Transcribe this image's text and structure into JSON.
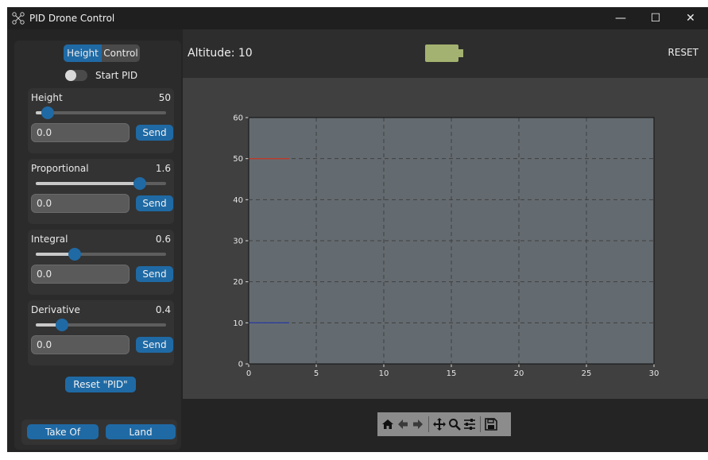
{
  "window": {
    "title": "PID Drone Control",
    "app_icon": "drone-icon"
  },
  "titlebar_controls": [
    {
      "name": "minimize-button",
      "glyph": "—"
    },
    {
      "name": "maximize-button",
      "glyph": "☐"
    },
    {
      "name": "close-button",
      "glyph": "✕"
    }
  ],
  "left_panel": {
    "tabs": [
      "Height",
      "Control"
    ],
    "active_tab": "Height",
    "switch_label": "Start PID",
    "switch_on": false,
    "params": [
      {
        "label": "Height",
        "value": "50",
        "slider_fraction": 0.09,
        "entry": "0.0",
        "button": "Send"
      },
      {
        "label": "Proportional",
        "value": "1.6",
        "slider_fraction": 0.8,
        "entry": "0.0",
        "button": "Send"
      },
      {
        "label": "Integral",
        "value": "0.6",
        "slider_fraction": 0.3,
        "entry": "0.0",
        "button": "Send"
      },
      {
        "label": "Derivative",
        "value": "0.4",
        "slider_fraction": 0.2,
        "entry": "0.0",
        "button": "Send"
      }
    ],
    "reset_pid_label": "Reset \"PID\"",
    "takeoff_label": "Take Of",
    "land_label": "Land"
  },
  "header": {
    "altitude_text": "Altitude: 10",
    "battery_icon": "battery-icon",
    "battery_color": "#a3b270",
    "reset_label": "RESET"
  },
  "chart_data": {
    "type": "line",
    "title": "",
    "xlabel": "",
    "ylabel": "",
    "xlim": [
      0,
      30
    ],
    "ylim": [
      0,
      60
    ],
    "xticks": [
      "0",
      "5",
      "10",
      "15",
      "20",
      "25",
      "30"
    ],
    "yticks": [
      "0",
      "10",
      "20",
      "30",
      "40",
      "50",
      "60"
    ],
    "grid": true,
    "grid_style": "dashed",
    "series": [
      {
        "color": "#c0392b",
        "x": [
          0,
          3
        ],
        "y": [
          50,
          50
        ]
      },
      {
        "color": "#2c3e9e",
        "x": [
          0,
          3
        ],
        "y": [
          10,
          10
        ]
      }
    ]
  },
  "toolbar": {
    "tools": [
      "home-icon",
      "back-arrow-icon",
      "forward-arrow-icon",
      "pan-icon",
      "zoom-icon",
      "configure-subplots-icon",
      "save-icon"
    ]
  }
}
